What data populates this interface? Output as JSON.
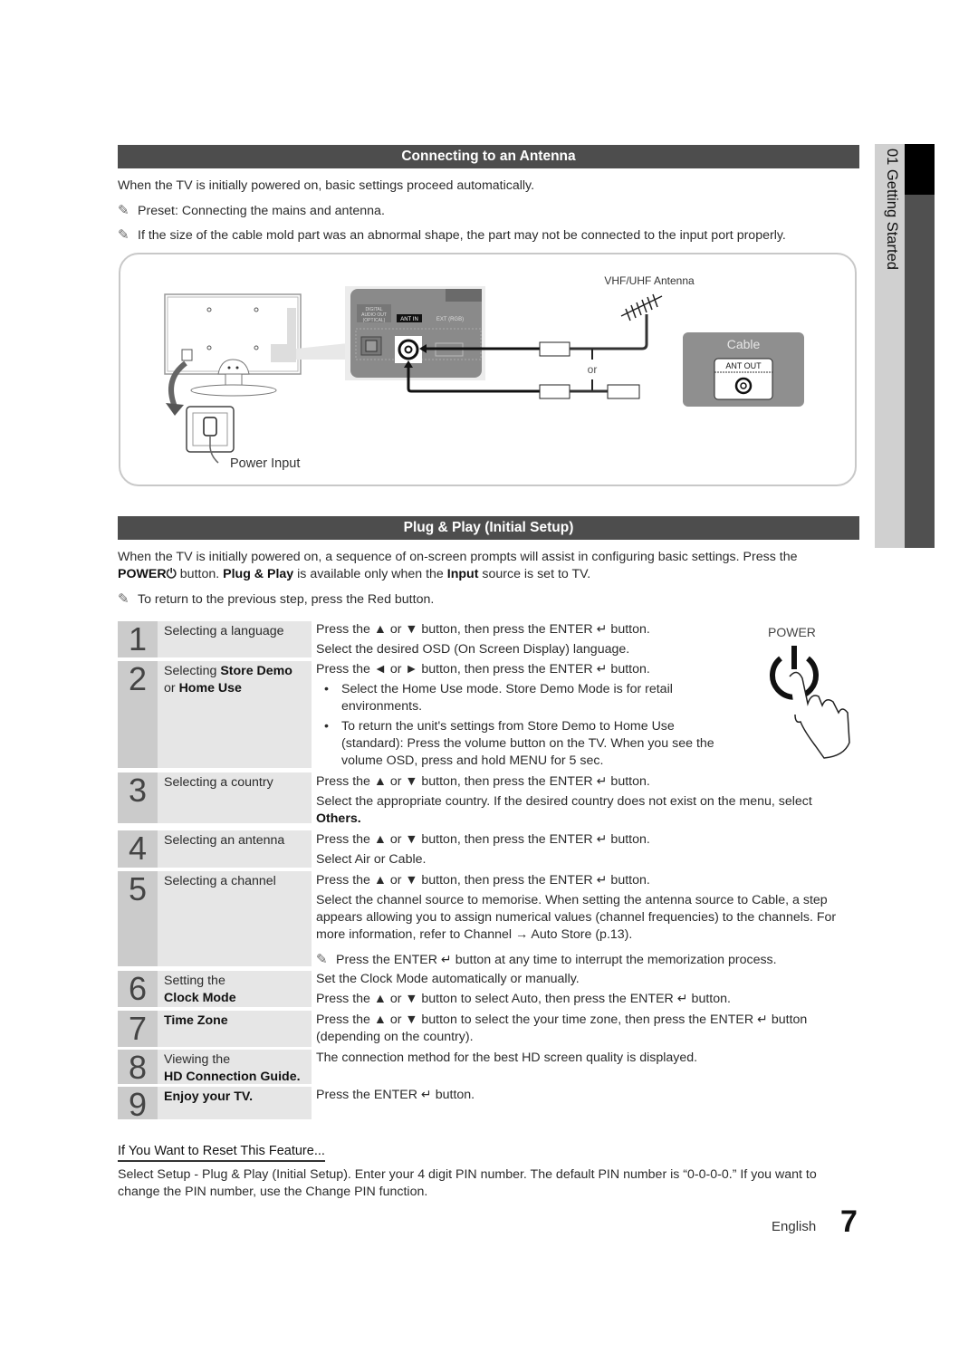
{
  "side_tab": {
    "chapter_number": "01",
    "chapter_title": "Getting Started",
    "text": "01  Getting Started"
  },
  "antenna_section": {
    "title": "Connecting to an Antenna",
    "intro": "When the TV is initially powered on, basic settings proceed automatically.",
    "notes": [
      "Preset: Connecting the mains and antenna.",
      "If the size of the cable mold part was an abnormal shape, the part may not be connected to the input port properly."
    ],
    "diagram": {
      "port_labels": [
        "DIGITAL AUDIO OUT (OPTICAL)",
        "ANT IN",
        "EXT (RGB)"
      ],
      "antenna_label": "VHF/UHF Antenna",
      "or_label": "or",
      "cable_label": "Cable",
      "ant_out_label": "ANT OUT",
      "power_input_label": "Power Input"
    }
  },
  "plug_play_section": {
    "title": "Plug & Play (Initial Setup)",
    "intro_line1": "When the TV is initially powered on, a sequence of on-screen prompts will assist in configuring basic settings. Press the",
    "intro_power": "POWER",
    "intro_l2a": " button. ",
    "intro_pp": "Plug & Play",
    "intro_l2b": " is available only when the ",
    "intro_input": "Input",
    "intro_l2c": " source is set to TV.",
    "note": "To return to the previous step, press the Red button.",
    "power_illustration_label": "POWER",
    "steps": [
      {
        "number": "1",
        "label": "Selecting a language",
        "lines": [
          "Press the ▲ or ▼ button, then press the ENTER ↵ button.",
          "Select the desired OSD (On Screen Display) language."
        ]
      },
      {
        "number": "2",
        "label_plain": "Selecting ",
        "label_bold1": "Store Demo",
        "label_plain2": "or ",
        "label_bold2": "Home Use",
        "line1": "Press the ◄ or ► button, then press the ENTER ↵ button.",
        "bullet1": "Select the Home Use mode. Store Demo Mode is for retail",
        "bullet1_cont": "environments.",
        "bullet2": "To return the unit's settings from Store Demo to Home Use",
        "bullet2_cont1": "(standard): Press the volume button on the TV. When you see the",
        "bullet2_cont2": "volume OSD, press and hold MENU for 5 sec."
      },
      {
        "number": "3",
        "label": "Selecting a country",
        "lines": [
          "Press the ▲ or ▼ button, then press the ENTER ↵ button.",
          "Select the appropriate country. If the desired country does not exist on the menu, select",
          "Others."
        ]
      },
      {
        "number": "4",
        "label": "Selecting an antenna",
        "lines": [
          "Press the ▲ or ▼ button, then press the ENTER ↵ button.",
          "Select Air or Cable."
        ]
      },
      {
        "number": "5",
        "label": "Selecting a channel",
        "lines": [
          "Press the ▲ or ▼ button, then press the ENTER ↵ button.",
          "Select the channel source to memorise. When setting the antenna source to Cable, a step",
          "appears allowing you to assign numerical values (channel frequencies) to the channels. For",
          "more information, refer to Channel → Auto Store (p.13)."
        ],
        "note": "Press the ENTER ↵ button at any time to interrupt the memorization process."
      },
      {
        "number": "6",
        "label_plain": "Setting the",
        "label_bold": "Clock Mode",
        "lines": [
          "Set the Clock Mode automatically or manually.",
          "Press the ▲ or ▼ button to select Auto, then press the ENTER ↵ button."
        ]
      },
      {
        "number": "7",
        "label_bold": "Time Zone",
        "lines": [
          "Press the ▲ or ▼ button to select the your time zone, then press the ENTER ↵ button",
          "(depending on the country)."
        ]
      },
      {
        "number": "8",
        "label_plain": "Viewing the",
        "label_bold": "HD Connection Guide.",
        "lines": [
          "The connection method for the best HD screen quality is displayed."
        ]
      },
      {
        "number": "9",
        "label_bold": "Enjoy your TV.",
        "lines": [
          "Press the ENTER ↵ button."
        ]
      }
    ]
  },
  "reset_section": {
    "title": "If You Want to Reset This Feature...",
    "line1": "Select Setup - Plug & Play (Initial Setup). Enter your 4 digit PIN number. The default PIN number is “0-0-0-0.” If you want to",
    "line2": "change the PIN number, use the Change PIN function."
  },
  "footer": {
    "language": "English",
    "page_number": "7"
  }
}
